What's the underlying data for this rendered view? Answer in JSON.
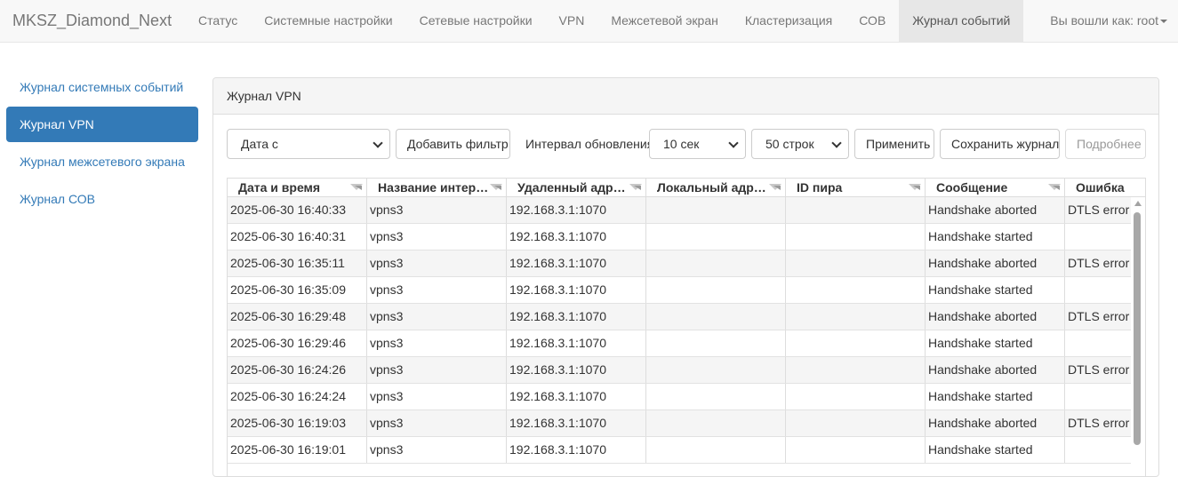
{
  "navbar": {
    "brand": "MKSZ_Diamond_Next",
    "items": [
      {
        "label": "Статус",
        "active": false
      },
      {
        "label": "Системные настройки",
        "active": false
      },
      {
        "label": "Сетевые настройки",
        "active": false
      },
      {
        "label": "VPN",
        "active": false
      },
      {
        "label": "Межсетевой экран",
        "active": false
      },
      {
        "label": "Кластеризация",
        "active": false
      },
      {
        "label": "СОВ",
        "active": false
      },
      {
        "label": "Журнал событий",
        "active": true
      }
    ],
    "user": "Вы вошли как: root"
  },
  "sidebar": {
    "items": [
      {
        "label": "Журнал системных событий",
        "active": false
      },
      {
        "label": "Журнал VPN",
        "active": true
      },
      {
        "label": "Журнал межсетевого экрана",
        "active": false
      },
      {
        "label": "Журнал СОВ",
        "active": false
      }
    ]
  },
  "panel": {
    "title": "Журнал VPN",
    "toolbar": {
      "date_select": "Дата с",
      "add_filter": "Добавить фильтр",
      "interval_label": "Интервал обновления",
      "interval_select": "10 сек",
      "rows_select": "50 строк",
      "apply": "Применить",
      "save": "Сохранить журнал",
      "details": "Подробнее"
    }
  },
  "table": {
    "columns": [
      "Дата и время",
      "Название интер…",
      "Удаленный адр…",
      "Локальный адр…",
      "ID пира",
      "Сообщение",
      "Ошибка"
    ],
    "rows": [
      [
        "2025-06-30 16:40:33",
        "vpns3",
        "192.168.3.1:1070",
        "",
        "",
        "Handshake aborted",
        "DTLS error"
      ],
      [
        "2025-06-30 16:40:31",
        "vpns3",
        "192.168.3.1:1070",
        "",
        "",
        "Handshake started",
        ""
      ],
      [
        "2025-06-30 16:35:11",
        "vpns3",
        "192.168.3.1:1070",
        "",
        "",
        "Handshake aborted",
        "DTLS error"
      ],
      [
        "2025-06-30 16:35:09",
        "vpns3",
        "192.168.3.1:1070",
        "",
        "",
        "Handshake started",
        ""
      ],
      [
        "2025-06-30 16:29:48",
        "vpns3",
        "192.168.3.1:1070",
        "",
        "",
        "Handshake aborted",
        "DTLS error"
      ],
      [
        "2025-06-30 16:29:46",
        "vpns3",
        "192.168.3.1:1070",
        "",
        "",
        "Handshake started",
        ""
      ],
      [
        "2025-06-30 16:24:26",
        "vpns3",
        "192.168.3.1:1070",
        "",
        "",
        "Handshake aborted",
        "DTLS error"
      ],
      [
        "2025-06-30 16:24:24",
        "vpns3",
        "192.168.3.1:1070",
        "",
        "",
        "Handshake started",
        ""
      ],
      [
        "2025-06-30 16:19:03",
        "vpns3",
        "192.168.3.1:1070",
        "",
        "",
        "Handshake aborted",
        "DTLS error"
      ],
      [
        "2025-06-30 16:19:01",
        "vpns3",
        "192.168.3.1:1070",
        "",
        "",
        "Handshake started",
        ""
      ]
    ]
  },
  "colors": {
    "accent": "#337ab7",
    "navbar_bg": "#f8f8f8",
    "row_stripe": "#f5f5f5"
  }
}
